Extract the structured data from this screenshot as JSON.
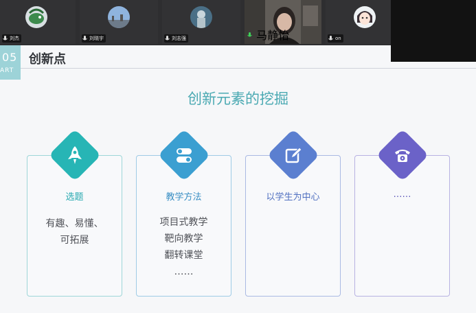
{
  "participants": [
    {
      "name": "刘杰",
      "avatar": "green-fish-avatar"
    },
    {
      "name": "刘晓宇",
      "avatar": "city-sky-avatar"
    },
    {
      "name": "刘志强",
      "avatar": "statue-avatar"
    },
    {
      "name": "马静怡",
      "avatar": "camera-video",
      "speaking": true
    },
    {
      "name": "on",
      "avatar": "cartoon-girl-avatar"
    }
  ],
  "slide": {
    "part_number": "05",
    "part_label": "ART",
    "title": "创新点",
    "subtitle": "创新元素的挖掘",
    "cards": [
      {
        "icon": "rocket-icon",
        "color": "#27b5b5",
        "title": "选题",
        "lines": [
          "有趣、易懂、",
          "可拓展"
        ]
      },
      {
        "icon": "toggle-icon",
        "color": "#3b9fd1",
        "title": "教学方法",
        "lines": [
          "项目式教学",
          "靶向教学",
          "翻转课堂",
          "……"
        ]
      },
      {
        "icon": "edit-icon",
        "color": "#5b7fd0",
        "title": "以学生为中心",
        "lines": []
      },
      {
        "icon": "telephone-icon",
        "color": "#6b62c8",
        "title": "……",
        "lines": []
      }
    ]
  }
}
